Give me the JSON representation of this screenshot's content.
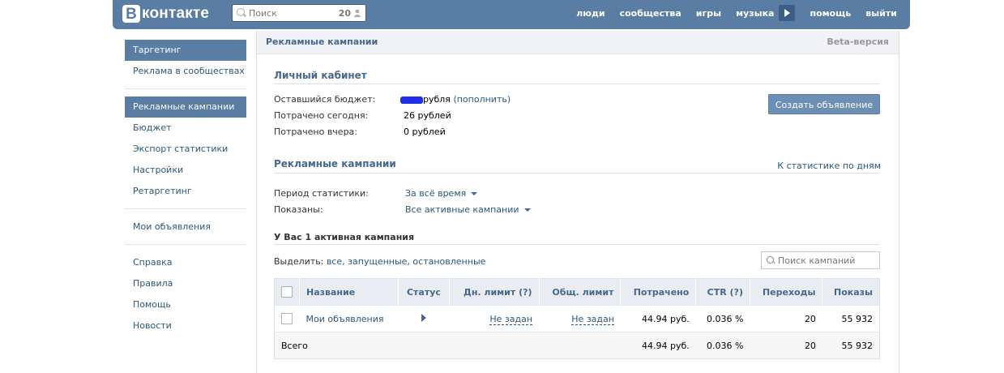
{
  "header": {
    "logo_letter": "В",
    "logo_text": "контакте",
    "search_placeholder": "Поиск",
    "search_count": "20",
    "nav": [
      "люди",
      "сообщества",
      "игры",
      "музыка",
      "помощь",
      "выйти"
    ]
  },
  "sidebar": {
    "group1": [
      "Таргетинг",
      "Реклама в сообществах"
    ],
    "group2": [
      "Рекламные кампании",
      "Бюджет",
      "Экспорт статистики",
      "Настройки",
      "Ретаргетинг"
    ],
    "group3": [
      "Мои объявления"
    ],
    "group4": [
      "Справка",
      "Правила",
      "Помощь",
      "Новости"
    ]
  },
  "page": {
    "title": "Рекламные кампании",
    "beta": "Beta-версия"
  },
  "cabinet": {
    "title": "Личный кабинет",
    "budget_label": "Оставшийся бюджет:",
    "budget_suffix": "рубля",
    "budget_link": "(пополнить)",
    "spent_today_label": "Потрачено сегодня:",
    "spent_today": "26 рублей",
    "spent_yesterday_label": "Потрачено вчера:",
    "spent_yesterday": "0 рублей",
    "create_button": "Создать объявление"
  },
  "campaigns": {
    "title": "Рекламные кампании",
    "stats_link": "К статистике по дням",
    "period_label": "Период статистики:",
    "period_value": "За всё время",
    "shown_label": "Показаны:",
    "shown_value": "Все активные кампании",
    "active_count_text": "У Вас 1 активная кампания",
    "select_label": "Выделить:",
    "select_options": "все, запущенные, остановленные",
    "search_placeholder": "Поиск кампаний",
    "columns": [
      "Название",
      "Статус",
      "Дн. лимит (?)",
      "Общ. лимит",
      "Потрачено",
      "CTR (?)",
      "Переходы",
      "Показы"
    ],
    "rows": [
      {
        "name": "Мои объявления",
        "day_limit": "Не задан",
        "total_limit": "Не задан",
        "spent": "44.94 руб.",
        "ctr": "0.036 %",
        "clicks": "20",
        "views": "55 932"
      }
    ],
    "total": {
      "label": "Всего",
      "spent": "44.94 руб.",
      "ctr": "0.036 %",
      "clicks": "20",
      "views": "55 932"
    }
  },
  "colors": {
    "header_bg": "#597da3",
    "link": "#2b587a",
    "accent": "#45688e"
  }
}
